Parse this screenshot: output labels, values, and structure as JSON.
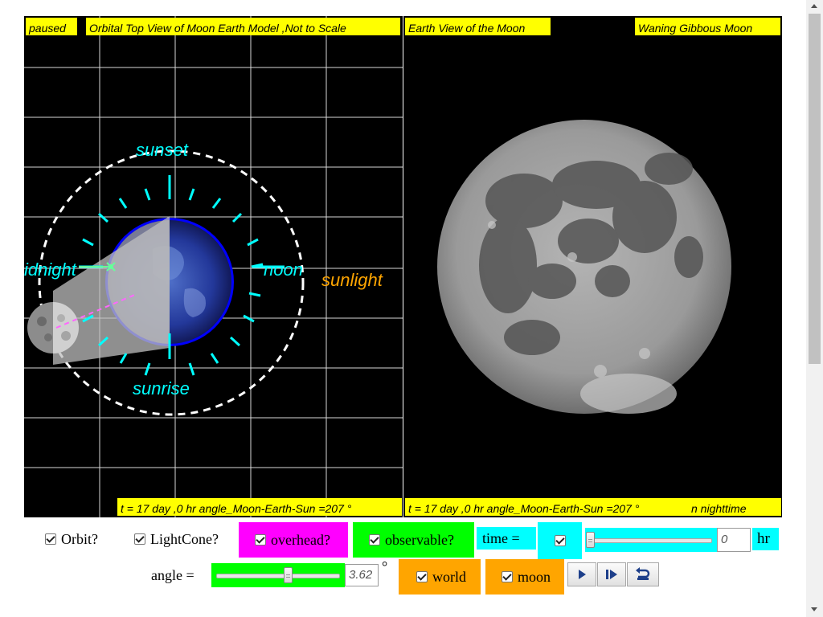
{
  "left_panel": {
    "status": "paused",
    "title": "Orbital Top View of Moon Earth Model ,Not to Scale",
    "label_sunset": "sunset",
    "label_sunrise": "sunrise",
    "label_midnight": "idnight",
    "label_noon": "noon",
    "label_sunlight": "sunlight",
    "footer": "t = 17 day ,0 hr angle_Moon-Earth-Sun =207 °"
  },
  "right_panel": {
    "title": "Earth View of the Moon",
    "phase": "Waning Gibbous Moon",
    "footer": "t = 17 day ,0 hr angle_Moon-Earth-Sun =207 °",
    "night_text": "n nighttime"
  },
  "controls": {
    "orbit_label": "Orbit?",
    "lightcone_label": "LightCone?",
    "overhead_label": "overhead?",
    "observable_label": "observable?",
    "time_label": "time =",
    "time_value": "0",
    "time_slider_fraction": 0.0,
    "time_unit": "hr",
    "angle_label": "angle =",
    "angle_value": "3.62",
    "angle_slider_fraction": 0.576,
    "angle_unit": "°",
    "world_label": "world",
    "moon_label": "moon"
  },
  "colors": {
    "label_bg": "#ffff00",
    "cyan": "#00ffff",
    "magenta": "#ff00ff",
    "green": "#00ff00",
    "orange": "#ffa500",
    "earth_blue": "#0000ff"
  },
  "icons": {
    "play": "play-icon",
    "step": "step-forward-icon",
    "reset": "reset-icon"
  }
}
